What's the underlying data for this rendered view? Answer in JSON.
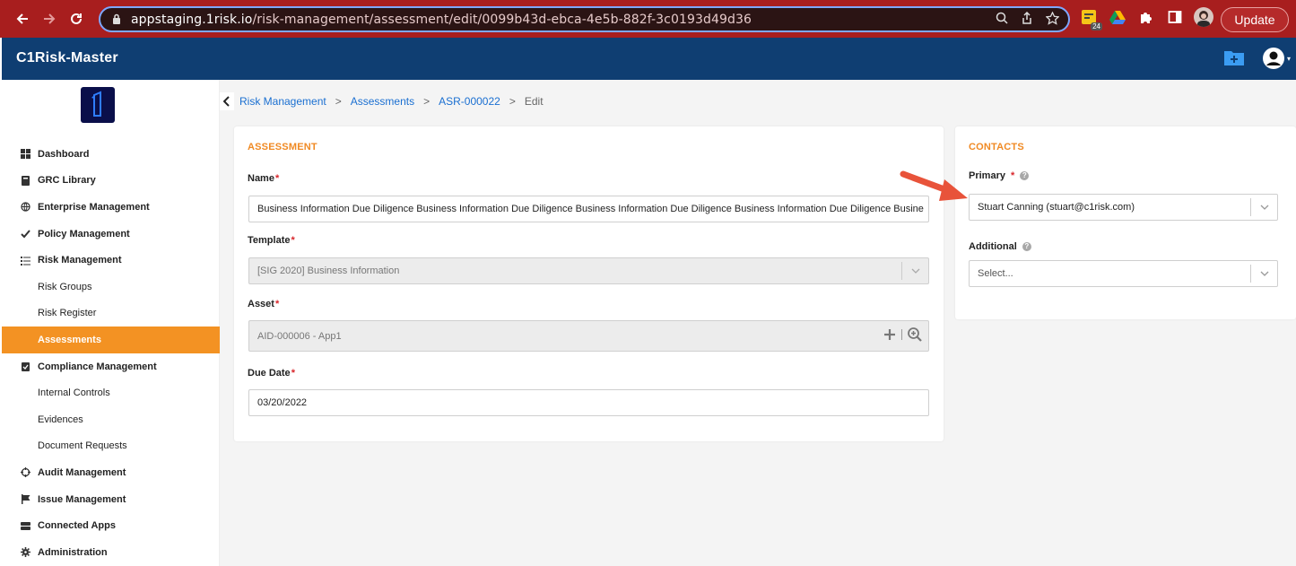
{
  "browser": {
    "url_host": "appstaging.1risk.io",
    "url_path": "/risk-management/assessment/edit/0099b43d-ebca-4e5b-882f-3c0193d49d36",
    "update_label": "Update",
    "extension_badge": "24"
  },
  "app": {
    "brand": "C1Risk-Master"
  },
  "sidebar": {
    "items": [
      {
        "label": "Dashboard",
        "icon": "grid-icon"
      },
      {
        "label": "GRC Library",
        "icon": "book-icon"
      },
      {
        "label": "Enterprise Management",
        "icon": "globe-icon"
      },
      {
        "label": "Policy Management",
        "icon": "check-icon"
      },
      {
        "label": "Risk Management",
        "icon": "list-icon"
      },
      {
        "label": "Risk Groups"
      },
      {
        "label": "Risk Register"
      },
      {
        "label": "Assessments"
      },
      {
        "label": "Compliance Management",
        "icon": "clipboard-check-icon"
      },
      {
        "label": "Internal Controls"
      },
      {
        "label": "Evidences"
      },
      {
        "label": "Document Requests"
      },
      {
        "label": "Audit Management",
        "icon": "crosshair-icon"
      },
      {
        "label": "Issue Management",
        "icon": "flag-icon"
      },
      {
        "label": "Connected Apps",
        "icon": "server-icon"
      },
      {
        "label": "Administration",
        "icon": "gear-icon"
      }
    ]
  },
  "breadcrumb": {
    "items": [
      "Risk Management",
      "Assessments",
      "ASR-000022"
    ],
    "current": "Edit",
    "separator": ">"
  },
  "assessment": {
    "title": "ASSESSMENT",
    "name_label": "Name",
    "name_value": "Business Information Due Diligence Business Information Due Diligence Business Information Due Diligence Business Information Due Diligence Busine",
    "template_label": "Template",
    "template_value": "[SIG 2020] Business Information",
    "asset_label": "Asset",
    "asset_value": "AID-000006 - App1",
    "due_label": "Due Date",
    "due_value": "03/20/2022",
    "required_mark": "*"
  },
  "contacts": {
    "title": "CONTACTS",
    "primary_label": "Primary",
    "primary_value": "Stuart Canning (stuart@c1risk.com)",
    "additional_label": "Additional",
    "additional_placeholder": "Select...",
    "help_glyph": "?"
  },
  "colors": {
    "chrome": "#a81e1e",
    "appbar": "#0f3e72",
    "accent": "#f39223",
    "link": "#1a6fd1",
    "arrow": "#e8533a"
  }
}
